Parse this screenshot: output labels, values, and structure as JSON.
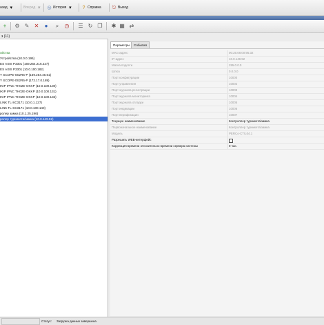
{
  "menubar": {
    "items": [
      {
        "label": "азад",
        "glyph": "▾"
      },
      {
        "label": "Вперед",
        "glyph": "▾"
      },
      {
        "label": "История",
        "glyph": "▾"
      },
      {
        "label": "Справка",
        "glyph": "?"
      },
      {
        "label": "Выход",
        "glyph": "⎋"
      }
    ]
  },
  "toolbar": {
    "icons": [
      "add-icon",
      "delete-icon",
      "refresh-icon",
      "settings-icon",
      "clock-icon",
      "copy-icon",
      "paste-icon",
      "list-icon",
      "edit-icon"
    ]
  },
  "tree": {
    "header": "з (11)",
    "items": [
      {
        "label": "ойства",
        "style": "green"
      },
      {
        "label": "Устройства (10.0.0.195)",
        "style": "normal"
      },
      {
        "label": "ES AXIS P3301 (169.254.216.227)",
        "style": "normal"
      },
      {
        "label": "ES AXIS P3301 (10.0.100.182)",
        "style": "normal"
      },
      {
        "label": "Y SCOPE-0S2R5-P (169.254.46.61)",
        "style": "normal"
      },
      {
        "label": "Y SCOPE-0S2R5-P (172.17.0.189)",
        "style": "normal"
      },
      {
        "label": "IKIP IPNC TH02E-OKKP (10.0.100.130)",
        "style": "normal"
      },
      {
        "label": "IKIP IPNC TH02E-OKKP (10.0.100.131)",
        "style": "normal"
      },
      {
        "label": "IKIP IPNC TH02E-OKKP (10.0.100.132)",
        "style": "normal"
      },
      {
        "label": "LINK TL-SC3171 (10.0.1.127)",
        "style": "normal"
      },
      {
        "label": "LINK TL-SC3171 (10.0.100.140)",
        "style": "normal"
      },
      {
        "label": "ролер замка (10.1.25.196)",
        "style": "normal"
      },
      {
        "label": "ролер турникета/замка (10.0.149.92)",
        "style": "selected"
      }
    ]
  },
  "tabs": [
    {
      "label": "Параметры",
      "active": true
    },
    {
      "label": "События",
      "active": false
    }
  ],
  "properties": [
    {
      "key": "MAC-адрес",
      "value": "00:25:08:00:95:32",
      "gray": true
    },
    {
      "key": "IP-адрес",
      "value": "10.0.149.92",
      "gray": true
    },
    {
      "key": "Маска подсети",
      "value": "255.0.0.0",
      "gray": true
    },
    {
      "key": "Шлюз",
      "value": "0.0.0.0",
      "gray": true
    },
    {
      "key": "Порт конфигурации",
      "value": "10000",
      "gray": true
    },
    {
      "key": "Порт управления",
      "value": "10002",
      "gray": true
    },
    {
      "key": "Порт журнала регистрации",
      "value": "10003",
      "gray": true
    },
    {
      "key": "Порт журнала мониторинга",
      "value": "10004",
      "gray": true
    },
    {
      "key": "Порт журнала отладки",
      "value": "10005",
      "gray": true
    },
    {
      "key": "Порт индикации",
      "value": "10006",
      "gray": true
    },
    {
      "key": "Порт верификации",
      "value": "10007",
      "gray": true
    },
    {
      "key": "Текущее наименование",
      "value": "Контроллер турникета/замка",
      "gray": false
    },
    {
      "key": "Первоначальное наименование",
      "value": "Контроллер турникета/замка",
      "gray": true
    },
    {
      "key": "Модель",
      "value": "PERCo-CT/L04.1",
      "gray": true
    },
    {
      "key": "Разрешить WEB-интерфейс",
      "value": "",
      "gray": false,
      "checkbox": true
    },
    {
      "key": "Коррекция времени относительно времени сервера системы",
      "value": "0 час.",
      "gray": false
    }
  ],
  "statusbar": {
    "label": "Статус:",
    "value": "Загрузка данных завершена"
  }
}
